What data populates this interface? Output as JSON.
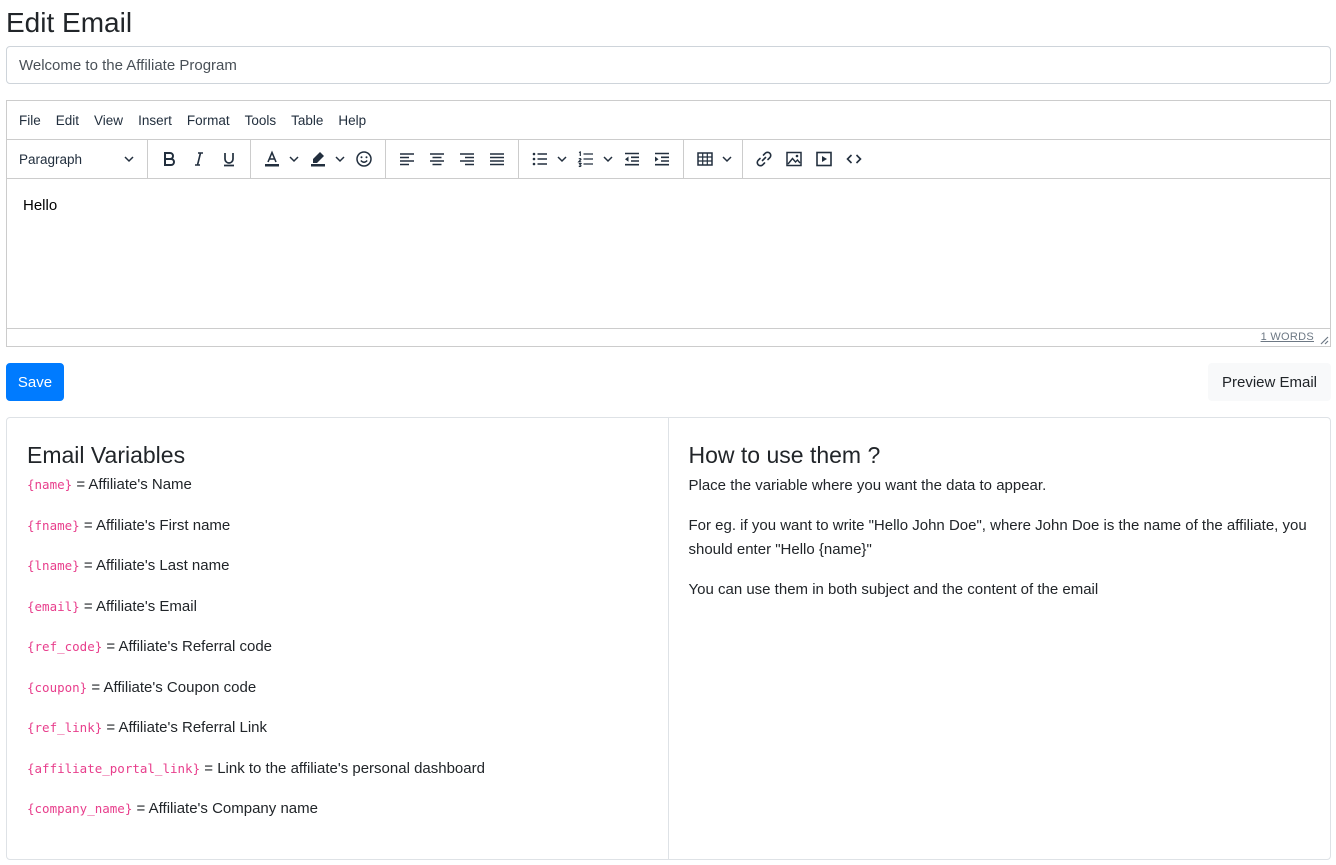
{
  "page": {
    "title": "Edit Email"
  },
  "subject": {
    "value": "Welcome to the Affiliate Program"
  },
  "editor": {
    "menu": [
      "File",
      "Edit",
      "View",
      "Insert",
      "Format",
      "Tools",
      "Table",
      "Help"
    ],
    "block_format": "Paragraph",
    "content": "Hello",
    "word_count": "1 WORDS",
    "toolbar_icons": [
      "bold-icon",
      "italic-icon",
      "underline-icon",
      "text-color-icon",
      "highlight-icon",
      "emoji-icon",
      "align-left-icon",
      "align-center-icon",
      "align-right-icon",
      "align-justify-icon",
      "bullet-list-icon",
      "numbered-list-icon",
      "outdent-icon",
      "indent-icon",
      "table-icon",
      "link-icon",
      "image-icon",
      "media-icon",
      "source-code-icon"
    ]
  },
  "actions": {
    "save_label": "Save",
    "preview_label": "Preview Email"
  },
  "variables": {
    "heading": "Email Variables",
    "items": [
      {
        "code": "{name}",
        "desc": " = Affiliate's Name"
      },
      {
        "code": "{fname}",
        "desc": " = Affiliate's First name"
      },
      {
        "code": "{lname}",
        "desc": " = Affiliate's Last name"
      },
      {
        "code": "{email}",
        "desc": " = Affiliate's Email"
      },
      {
        "code": "{ref_code}",
        "desc": " = Affiliate's Referral code"
      },
      {
        "code": "{coupon}",
        "desc": " = Affiliate's Coupon code"
      },
      {
        "code": "{ref_link}",
        "desc": " = Affiliate's Referral Link"
      },
      {
        "code": "{affiliate_portal_link}",
        "desc": " = Link to the affiliate's personal dashboard"
      },
      {
        "code": "{company_name}",
        "desc": " = Affiliate's Company name"
      }
    ]
  },
  "howto": {
    "heading": "How to use them ?",
    "paragraphs": [
      "Place the variable where you want the data to appear.",
      "For eg. if you want to write \"Hello John Doe\", where John Doe is the name of the affiliate, you should enter \"Hello {name}\"",
      "You can use them in both subject and the content of the email"
    ]
  },
  "colors": {
    "primary": "#007bff",
    "code": "#e83e8c",
    "border": "#dee2e6"
  }
}
